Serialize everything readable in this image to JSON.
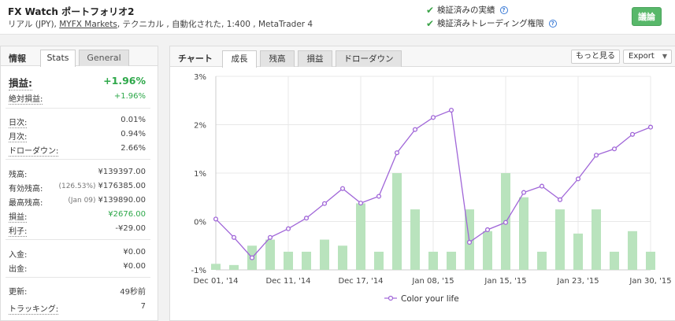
{
  "header": {
    "title": "FX Watch ポートフォリオ2",
    "account": "リアル (JPY), ",
    "broker": "MYFX Markets",
    "details": ", テクニカル , 自動化された, 1:400 , MetaTrader 4",
    "verified_record": "検証済みの実績",
    "verified_privileges": "検証済みトレーディング権限",
    "discuss_button": "議論"
  },
  "left": {
    "panel_label": "情報",
    "tabs": [
      "Stats",
      "General"
    ],
    "stats": {
      "gain_label": "損益:",
      "gain_value": "+1.96%",
      "abs_gain_label": "絶対損益:",
      "abs_gain_value": "+1.96%",
      "daily_label": "日次:",
      "daily_value": "0.01%",
      "monthly_label": "月次:",
      "monthly_value": "0.94%",
      "drawdown_label": "ドローダウン:",
      "drawdown_value": "2.66%",
      "balance_label": "残高:",
      "balance_value": "¥139397.00",
      "equity_label": "有効残高:",
      "equity_paren": "(126.53%)",
      "equity_value": "¥176385.00",
      "highest_label": "最高残高:",
      "highest_paren": "(Jan 09)",
      "highest_value": "¥139890.00",
      "profit_label": "損益:",
      "profit_value": "¥2676.00",
      "interest_label": "利子:",
      "interest_value": "-¥29.00",
      "deposits_label": "入金:",
      "deposits_value": "¥0.00",
      "withdrawals_label": "出金:",
      "withdrawals_value": "¥0.00",
      "updated_label": "更新:",
      "updated_value": "49秒前",
      "tracking_label": "トラッキング:",
      "tracking_value": "7"
    }
  },
  "chart_panel": {
    "label": "チャート",
    "tabs": [
      "成長",
      "残高",
      "損益",
      "ドローダウン"
    ],
    "more_button": "もっと見る",
    "export_button": "Export"
  },
  "colors": {
    "line": "#a066d8",
    "bar": "#b9e3bd",
    "positive": "#2ea84a",
    "discuss_button": "#58b86a"
  },
  "chart_data": {
    "type": "line",
    "title": "",
    "xlabel": "",
    "ylabel": "",
    "ylim": [
      -1,
      3
    ],
    "y_ticks": [
      "-1%",
      "0%",
      "1%",
      "2%",
      "3%"
    ],
    "x_tick_labels": [
      "Dec 01, '14",
      "Dec 11, '14",
      "Dec 17, '14",
      "Jan 08, '15",
      "Jan 15, '15",
      "Jan 23, '15",
      "Jan 30, '15"
    ],
    "x_tick_index": [
      0,
      4,
      8,
      12,
      16,
      20,
      24
    ],
    "legend": "bottom-center",
    "series": [
      {
        "name": "Color your life",
        "type": "line",
        "values": [
          0.05,
          -0.33,
          -0.75,
          -0.33,
          -0.15,
          0.07,
          0.37,
          0.68,
          0.38,
          0.52,
          1.42,
          1.9,
          2.15,
          2.3,
          -0.43,
          -0.17,
          -0.02,
          0.6,
          0.73,
          0.45,
          0.88,
          1.37,
          1.5,
          1.8,
          1.95
        ]
      },
      {
        "name": "",
        "type": "bar",
        "values": [
          0.05,
          0.04,
          0.2,
          0.25,
          0.15,
          0.15,
          0.25,
          0.2,
          0.55,
          0.15,
          0.8,
          0.5,
          0.15,
          0.15,
          0.5,
          0.32,
          0.8,
          0.6,
          0.15,
          0.5,
          0.3,
          0.5,
          0.15,
          0.32,
          0.15
        ]
      }
    ],
    "bar_axis_max": 1.6
  }
}
